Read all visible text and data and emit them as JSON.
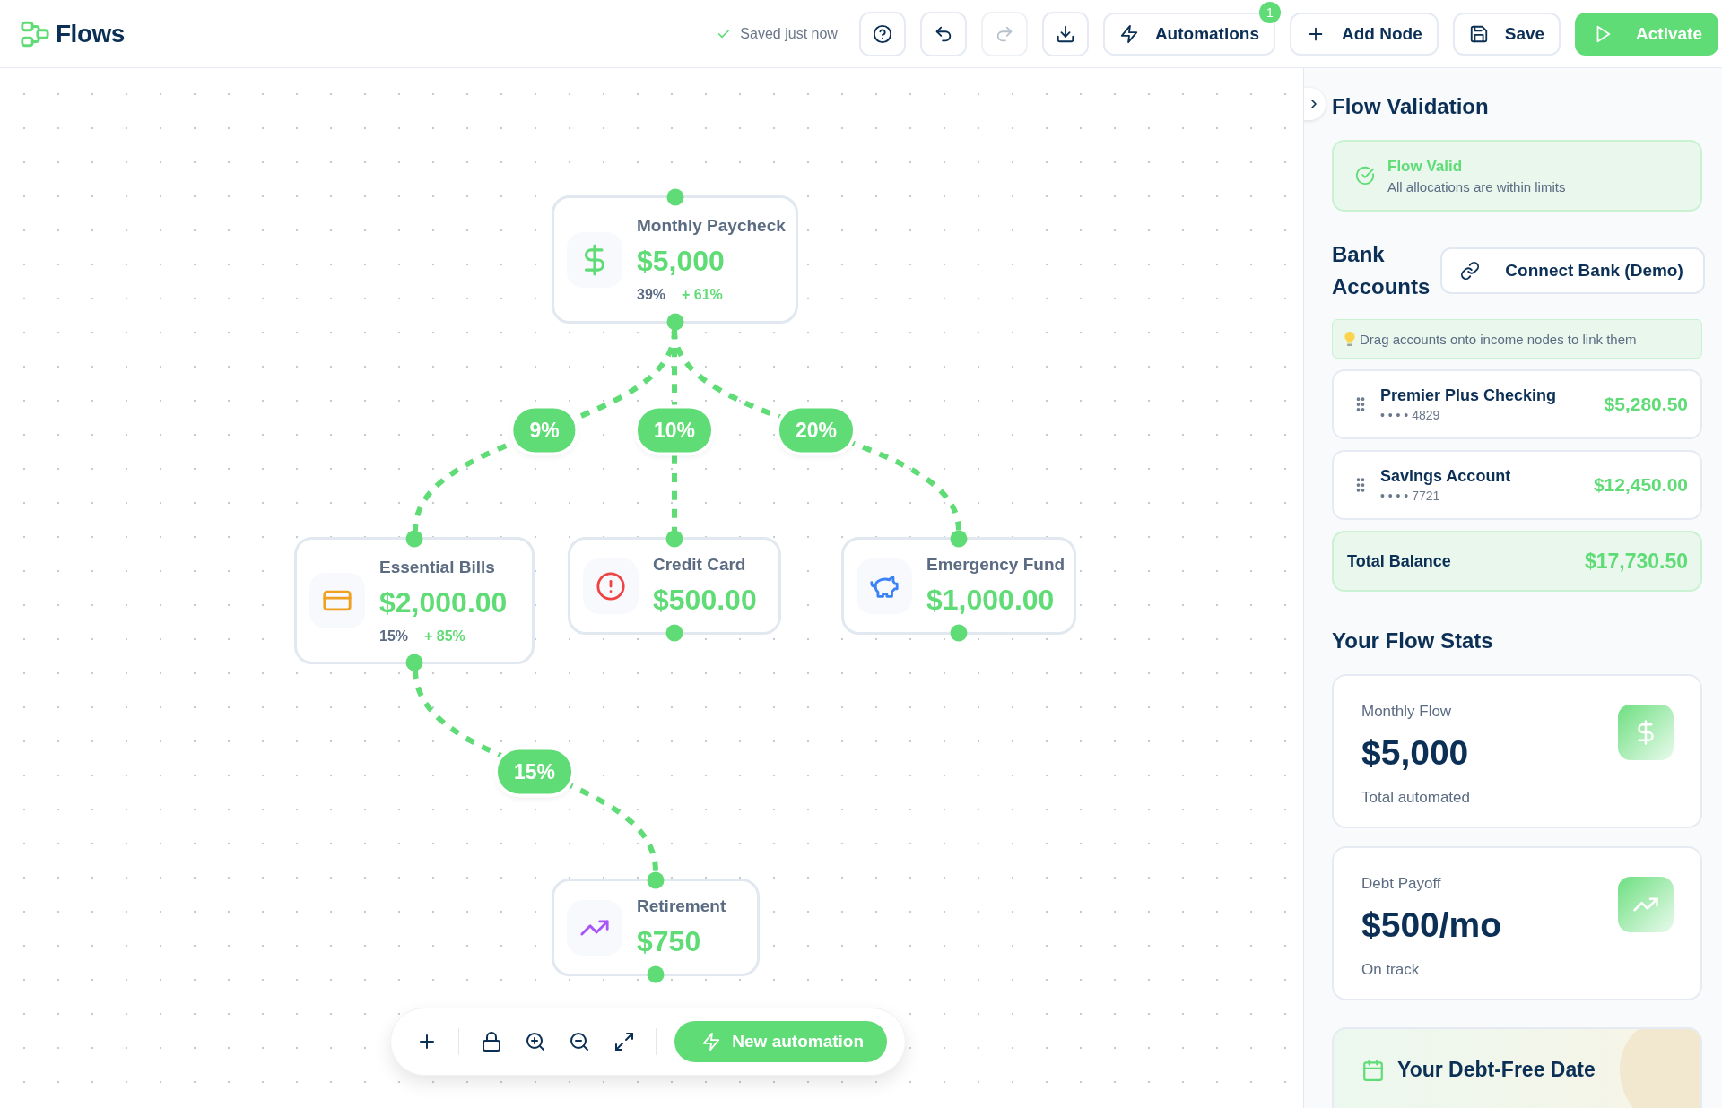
{
  "top_bar": {
    "logo": "Flows",
    "save_status": "Saved just now",
    "icon_buttons": [
      {
        "kind": "help",
        "disabled": false
      },
      {
        "kind": "undo",
        "disabled": false
      },
      {
        "kind": "redo",
        "disabled": true
      },
      {
        "kind": "download",
        "disabled": false
      }
    ],
    "buttons": [
      {
        "kind": "automations",
        "label": "Automations",
        "badge": "1"
      },
      {
        "kind": "add",
        "label": "Add Node"
      },
      {
        "kind": "save",
        "label": "Save"
      },
      {
        "kind": "activate",
        "label": "Activate"
      }
    ]
  },
  "canvas": {
    "nodes": [
      {
        "kind": "income",
        "title": "Monthly Paycheck",
        "amount": "$5,000",
        "stats": [
          {
            "kind": "used",
            "text": "39%"
          },
          {
            "kind": "remaining",
            "text": "+ 61%"
          }
        ]
      },
      {
        "kind": "bill",
        "title": "Essential Bills",
        "amount": "$2,000.00",
        "stats": [
          {
            "kind": "used",
            "text": "15%"
          },
          {
            "kind": "remaining",
            "text": "+ 85%"
          }
        ]
      },
      {
        "kind": "debt",
        "title": "Credit Card",
        "amount": "$500.00"
      },
      {
        "kind": "savings",
        "title": "Emergency Fund",
        "amount": "$1,000.00"
      },
      {
        "kind": "investment",
        "title": "Retirement",
        "amount": "$750"
      }
    ],
    "edges": [
      {
        "label": "9%"
      },
      {
        "label": "10%"
      },
      {
        "label": "20%"
      },
      {
        "label": "15%"
      }
    ],
    "controls": [
      {
        "kind": "add"
      },
      {
        "kind": "lock"
      },
      {
        "kind": "zoom_in"
      },
      {
        "kind": "zoom_out"
      },
      {
        "kind": "fit"
      }
    ],
    "new_automation": "New automation"
  },
  "side_panel": {
    "validation": {
      "title": "Flow Validation",
      "status": "Flow Valid",
      "message": "All allocations are within limits"
    },
    "bank": {
      "title": "Bank Accounts",
      "connect_button": "Connect Bank (Demo)",
      "hint": "Drag accounts onto income nodes to link them",
      "accounts": [
        {
          "name": "Premier Plus Checking",
          "number": "• • • • 4829",
          "balance": "$5,280.50"
        },
        {
          "name": "Savings Account",
          "number": "• • • • 7721",
          "balance": "$12,450.00"
        }
      ],
      "total_label": "Total Balance",
      "total": "$17,730.50"
    },
    "stats": {
      "title": "Your Flow Stats",
      "cards": [
        {
          "kind": "dollar",
          "label": "Monthly Flow",
          "value": "$5,000",
          "note": "Total automated"
        },
        {
          "kind": "trend",
          "label": "Debt Payoff",
          "value": "$500/mo",
          "note": "On track"
        }
      ]
    },
    "debt_free": {
      "title": "Your Debt-Free Date"
    }
  }
}
